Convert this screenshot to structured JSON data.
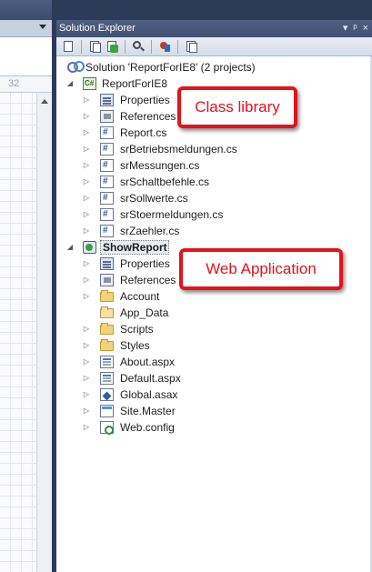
{
  "panel": {
    "title": "Solution Explorer",
    "header_icons": [
      "▾",
      "ᵖ",
      "×"
    ]
  },
  "toolbar": {
    "icons": [
      "properties-icon",
      "show-all-files-icon",
      "refresh-icon",
      "view-class-diagram-icon",
      "nest-related-files-icon",
      "view-code-icon"
    ]
  },
  "editor": {
    "ruler_number": "32"
  },
  "tree": {
    "solution": "Solution 'ReportForIE8' (2 projects)",
    "project1": {
      "name": "ReportForIE8",
      "items": [
        "Properties",
        "References",
        "Report.cs",
        "srBetriebsmeldungen.cs",
        "srMessungen.cs",
        "srSchaltbefehle.cs",
        "srSollwerte.cs",
        "srStoermeldungen.cs",
        "srZaehler.cs"
      ]
    },
    "project2": {
      "name": "ShowReport",
      "items": [
        "Properties",
        "References",
        "Account",
        "App_Data",
        "Scripts",
        "Styles",
        "About.aspx",
        "Default.aspx",
        "Global.asax",
        "Site.Master",
        "Web.config"
      ]
    }
  },
  "annotations": {
    "class_library": "Class library",
    "web_application": "Web Application"
  },
  "colors": {
    "ide_frame": "#2b3c59",
    "annotation_red": "#e3121b"
  }
}
